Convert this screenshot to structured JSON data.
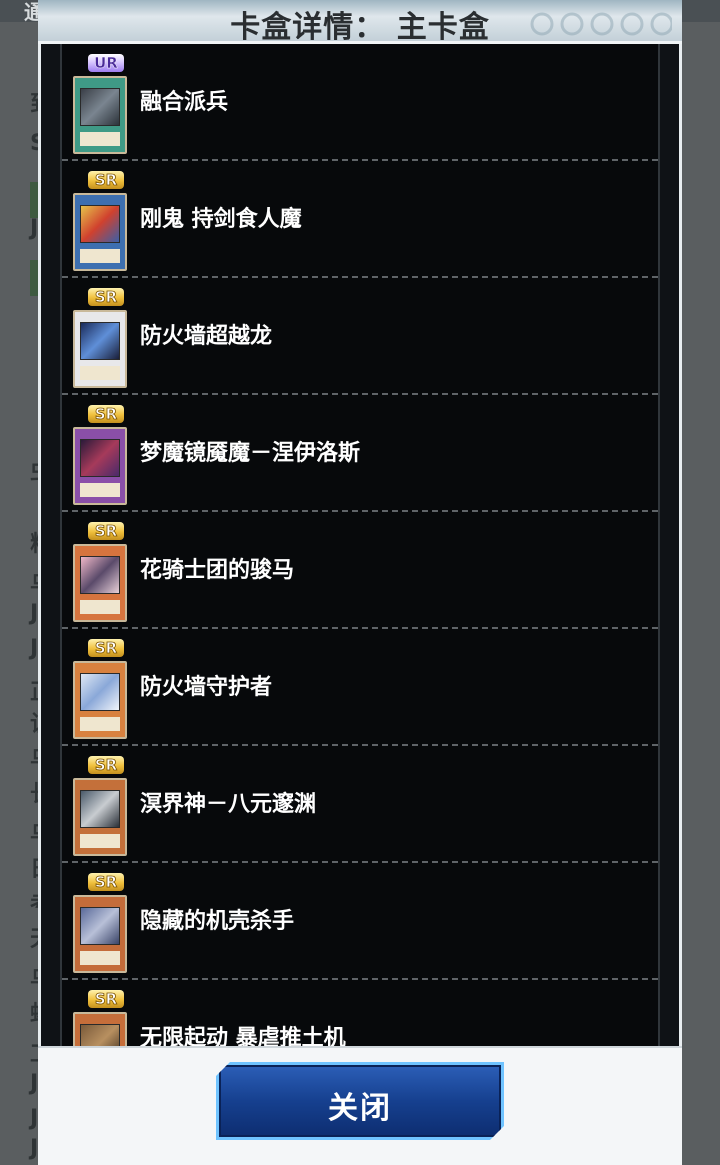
{
  "background": {
    "notice_text": "通知",
    "glyphs": [
      "到",
      "S",
      "J",
      "虫",
      "粗",
      "乌",
      "J",
      "J",
      "正",
      "诅",
      "乌",
      "长",
      "乌",
      "日",
      "考",
      "天",
      "乌",
      "蛇",
      "工",
      "J",
      "J",
      "J"
    ]
  },
  "dialog": {
    "title": "卡盒详情： 主卡盒",
    "close_label": "关闭"
  },
  "cards": [
    {
      "rarity": "UR",
      "name": "融合派兵",
      "card_color": "#3f9a86"
    },
    {
      "rarity": "SR",
      "name": "刚鬼 持剑食人魔",
      "card_color": "#3d6fb0"
    },
    {
      "rarity": "SR",
      "name": "防火墙超越龙",
      "card_color": "#e8e8ea"
    },
    {
      "rarity": "SR",
      "name": "梦魔镜魇魔－涅伊洛斯",
      "card_color": "#8a4fa8"
    },
    {
      "rarity": "SR",
      "name": "花骑士团的骏马",
      "card_color": "#d6743e"
    },
    {
      "rarity": "SR",
      "name": "防火墙守护者",
      "card_color": "#d8813f"
    },
    {
      "rarity": "SR",
      "name": "溟界神－八元邃渊",
      "card_color": "#c4703a"
    },
    {
      "rarity": "SR",
      "name": "隐藏的机壳杀手",
      "card_color": "#c46c3a"
    },
    {
      "rarity": "SR",
      "name": "无限起动 暴虐推土机",
      "card_color": "#c66e3a"
    }
  ],
  "colors": {
    "list_background": "#07090b",
    "close_button": "#16408f",
    "close_button_border": "#6fc3ff"
  }
}
